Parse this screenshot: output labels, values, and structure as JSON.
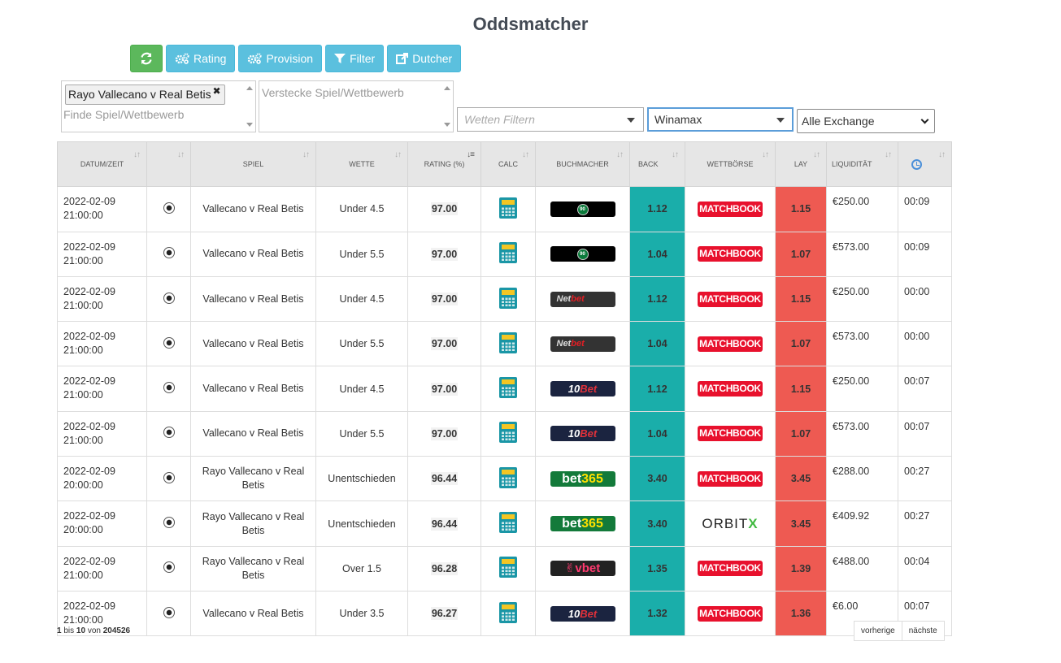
{
  "title": "Oddsmatcher",
  "toolbar": {
    "refresh_icon": "refresh-icon",
    "rating": "Rating",
    "provision": "Provision",
    "filter": "Filter",
    "dutcher": "Dutcher"
  },
  "search": {
    "selected_tag": "Rayo Vallecano v Real Betis",
    "find_placeholder": "Finde Spiel/Wettbewerb",
    "hide_placeholder": "Verstecke Spiel/Wettbewerb",
    "bet_filter_placeholder": "Wetten Filtern",
    "bookmaker_selected": "Winamax",
    "exchange_selected": "Alle Exchange"
  },
  "table": {
    "headers": [
      "Datum/Zeit",
      "",
      "Spiel",
      "Wette",
      "Rating (%)",
      "Calc",
      "Buchmacher",
      "Back",
      "Wettbörse",
      "Lay",
      "Liquidität",
      ""
    ],
    "rows": [
      {
        "date": "2022-02-09",
        "time": "21:00:00",
        "game": "Vallecano v Real Betis",
        "bet": "Under 4.5",
        "rating": "97.00",
        "bookmaker": "bet90",
        "back": "1.12",
        "exchange": "matchbook",
        "lay": "1.15",
        "liquidity": "€250.00",
        "age": "00:09"
      },
      {
        "date": "2022-02-09",
        "time": "21:00:00",
        "game": "Vallecano v Real Betis",
        "bet": "Under 5.5",
        "rating": "97.00",
        "bookmaker": "bet90",
        "back": "1.04",
        "exchange": "matchbook",
        "lay": "1.07",
        "liquidity": "€573.00",
        "age": "00:09"
      },
      {
        "date": "2022-02-09",
        "time": "21:00:00",
        "game": "Vallecano v Real Betis",
        "bet": "Under 4.5",
        "rating": "97.00",
        "bookmaker": "netbet",
        "back": "1.12",
        "exchange": "matchbook",
        "lay": "1.15",
        "liquidity": "€250.00",
        "age": "00:00"
      },
      {
        "date": "2022-02-09",
        "time": "21:00:00",
        "game": "Vallecano v Real Betis",
        "bet": "Under 5.5",
        "rating": "97.00",
        "bookmaker": "netbet",
        "back": "1.04",
        "exchange": "matchbook",
        "lay": "1.07",
        "liquidity": "€573.00",
        "age": "00:00"
      },
      {
        "date": "2022-02-09",
        "time": "21:00:00",
        "game": "Vallecano v Real Betis",
        "bet": "Under 4.5",
        "rating": "97.00",
        "bookmaker": "10bet",
        "back": "1.12",
        "exchange": "matchbook",
        "lay": "1.15",
        "liquidity": "€250.00",
        "age": "00:07"
      },
      {
        "date": "2022-02-09",
        "time": "21:00:00",
        "game": "Vallecano v Real Betis",
        "bet": "Under 5.5",
        "rating": "97.00",
        "bookmaker": "10bet",
        "back": "1.04",
        "exchange": "matchbook",
        "lay": "1.07",
        "liquidity": "€573.00",
        "age": "00:07"
      },
      {
        "date": "2022-02-09",
        "time": "20:00:00",
        "game": "Rayo Vallecano v Real Betis",
        "bet": "Unentschieden",
        "rating": "96.44",
        "bookmaker": "bet365",
        "back": "3.40",
        "exchange": "matchbook",
        "lay": "3.45",
        "liquidity": "€288.00",
        "age": "00:27"
      },
      {
        "date": "2022-02-09",
        "time": "20:00:00",
        "game": "Rayo Vallecano v Real Betis",
        "bet": "Unentschieden",
        "rating": "96.44",
        "bookmaker": "bet365",
        "back": "3.40",
        "exchange": "orbitx",
        "lay": "3.45",
        "liquidity": "€409.92",
        "age": "00:27"
      },
      {
        "date": "2022-02-09",
        "time": "21:00:00",
        "game": "Rayo Vallecano v Real Betis",
        "bet": "Over 1.5",
        "rating": "96.28",
        "bookmaker": "vbet",
        "back": "1.35",
        "exchange": "matchbook",
        "lay": "1.39",
        "liquidity": "€488.00",
        "age": "00:04"
      },
      {
        "date": "2022-02-09",
        "time": "21:00:00",
        "game": "Vallecano v Real Betis",
        "bet": "Under 3.5",
        "rating": "96.27",
        "bookmaker": "10bet",
        "back": "1.32",
        "exchange": "matchbook",
        "lay": "1.36",
        "liquidity": "€6.00",
        "age": "00:07"
      }
    ]
  },
  "logos": {
    "bet90": "90",
    "netbet_a": "Net",
    "netbet_b": "bet",
    "tenbet_a": "10",
    "tenbet_b": "Bet",
    "bet365_a": "bet",
    "bet365_b": "365",
    "vbet": "✌vbet",
    "matchbook": "MATCHBOOK",
    "orbitx_a": "ORBIT",
    "orbitx_b": "X"
  },
  "pagination": {
    "from": "1",
    "to": "10",
    "total": "204526",
    "bis": "bis",
    "von": "von",
    "prev": "vorherige",
    "next": "nächste"
  }
}
